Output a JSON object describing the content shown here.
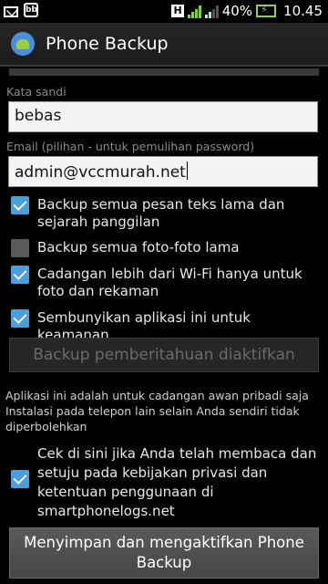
{
  "status_bar": {
    "icons_left": [
      "mail-icon",
      "bbm-icon"
    ],
    "network_indicator": "H",
    "battery_percent": "40%",
    "time": "10.45"
  },
  "app_bar": {
    "title": "Phone Backup",
    "icon": "android-icon"
  },
  "password": {
    "label": "Kata sandi",
    "value": "bebas"
  },
  "email": {
    "label": "Email (pilihan - untuk pemulihan password)",
    "value": "admin@vccmurah.net"
  },
  "options": [
    {
      "label": "Backup semua pesan teks lama dan sejarah panggilan",
      "checked": true
    },
    {
      "label": "Backup semua foto-foto lama",
      "checked": false
    },
    {
      "label": "Cadangan lebih dari Wi-Fi hanya untuk foto dan rekaman",
      "checked": true
    },
    {
      "label": "Sembunyikan aplikasi ini untuk keamanan",
      "checked": true
    }
  ],
  "notify_button": "Backup pemberitahuan diaktifkan",
  "info_text": "Aplikasi ini adalah untuk cadangan awan pribadi saja Instalasi pada telepon lain selain Anda sendiri tidak diperbolehkan",
  "agree": {
    "label": "Cek di sini jika Anda telah membaca dan setuju pada kebijakan privasi dan ketentuan penggunaan di smartphonelogs.net",
    "checked": true
  },
  "save_button": "Menyimpan dan mengaktifkan Phone Backup",
  "colors": {
    "accent": "#49a0dd",
    "background": "#000000"
  }
}
